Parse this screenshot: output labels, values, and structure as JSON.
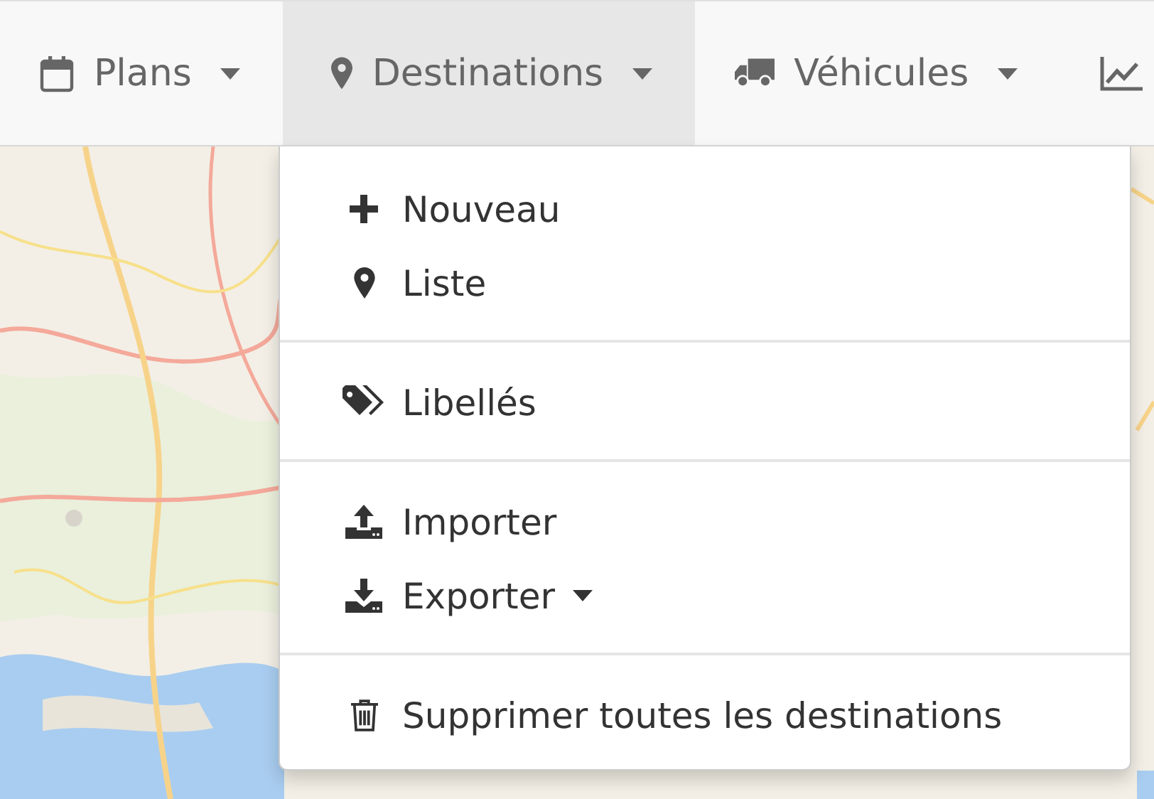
{
  "navbar": {
    "tabs": [
      {
        "label": "Plans",
        "selected": false,
        "dropdown": true
      },
      {
        "label": "Destinations",
        "selected": true,
        "dropdown": true
      },
      {
        "label": "Véhicules",
        "selected": false,
        "dropdown": true
      }
    ]
  },
  "dropdown_menu": {
    "groups": [
      [
        {
          "label": "Nouveau",
          "submenu": false
        },
        {
          "label": "Liste",
          "submenu": false
        }
      ],
      [
        {
          "label": "Libellés",
          "submenu": false
        }
      ],
      [
        {
          "label": "Importer",
          "submenu": false
        },
        {
          "label": "Exporter",
          "submenu": true
        }
      ],
      [
        {
          "label": "Supprimer toutes les destinations",
          "submenu": false
        }
      ]
    ]
  }
}
